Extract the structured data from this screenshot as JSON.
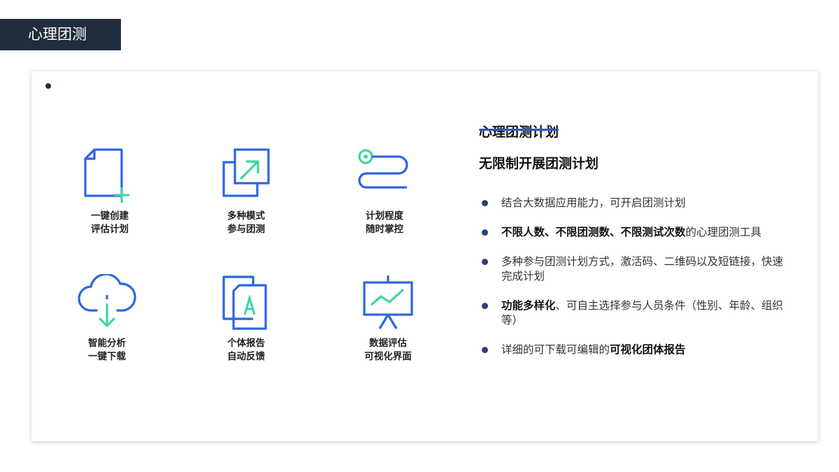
{
  "header": {
    "title": "心理团测"
  },
  "features": [
    {
      "icon": "new-document-icon",
      "line1": "一键创建",
      "line2": "评估计划"
    },
    {
      "icon": "export-copy-icon",
      "line1": "多种模式",
      "line2": "参与团测"
    },
    {
      "icon": "progress-path-icon",
      "line1": "计划程度",
      "line2": "随时掌控"
    },
    {
      "icon": "cloud-download-icon",
      "line1": "智能分析",
      "line2": "一键下载"
    },
    {
      "icon": "report-document-icon",
      "line1": "个体报告",
      "line2": "自动反馈"
    },
    {
      "icon": "chart-board-icon",
      "line1": "数据评估",
      "line2": "可视化界面"
    }
  ],
  "plan": {
    "title": "心理团测计划",
    "subtitle": "无限制开展团测计划",
    "bullets": [
      {
        "bold": "",
        "text": "结合大数据应用能力，可开启团测计划"
      },
      {
        "bold": "不限人数、不限团测数、不限测试次数",
        "text": "的心理团测工具"
      },
      {
        "bold": "",
        "text": "多种参与团测计划方式，激活码、二维码以及短链接，快速完成计划"
      },
      {
        "bold": "功能多样化",
        "text": "、可自主选择参与人员条件（性别、年龄、组织等）"
      },
      {
        "text_prefix": "详细的可下载可编辑的",
        "bold": "可视化团体报告"
      }
    ]
  },
  "colors": {
    "blue": "#2a66e0",
    "teal": "#3fd3a8",
    "tab": "#1f2d3d"
  }
}
